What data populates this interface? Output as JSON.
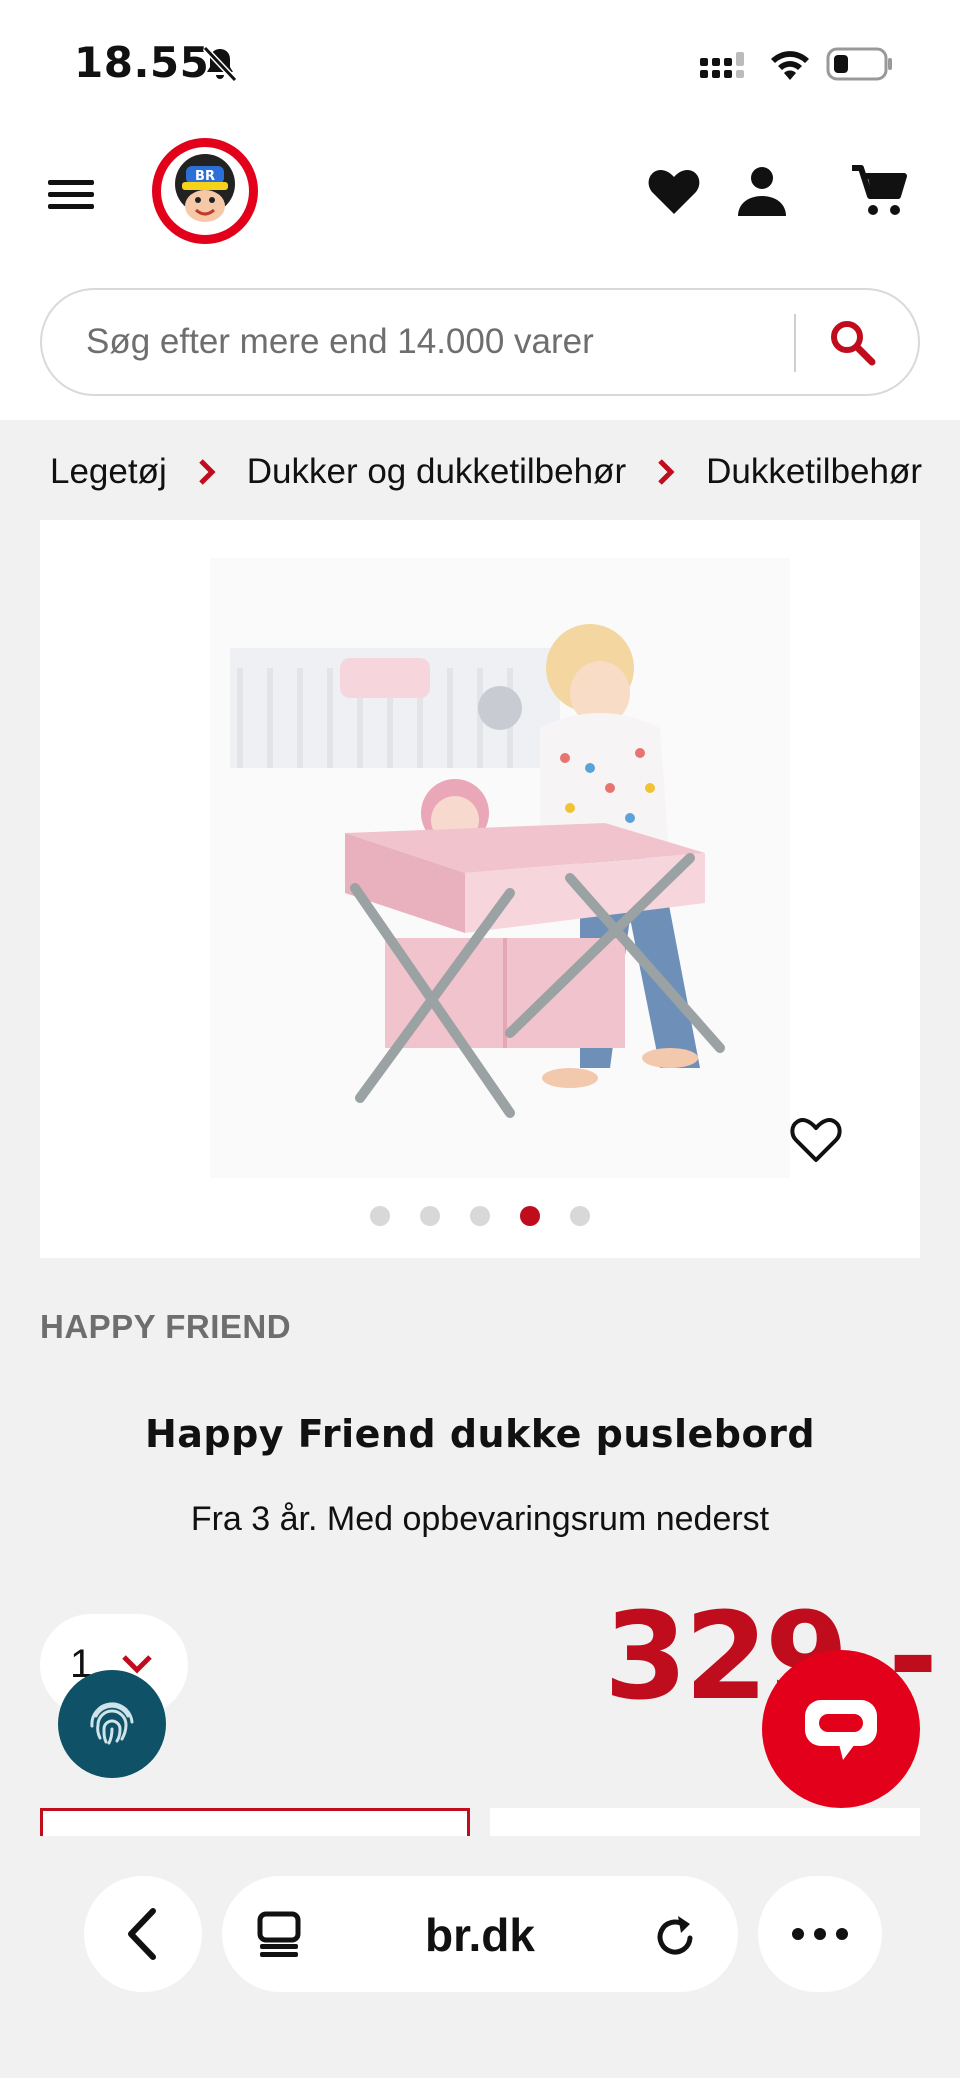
{
  "status_bar": {
    "time": "18.55"
  },
  "search": {
    "placeholder": "Søg efter mere end 14.000 varer"
  },
  "breadcrumb": [
    "Legetøj",
    "Dukker og dukketilbehør",
    "Dukketilbehør"
  ],
  "gallery": {
    "slide_count": 5,
    "active_slide": 4
  },
  "product": {
    "brand": "HAPPY FRIEND",
    "title": "Happy Friend dukke puslebord",
    "subtitle": "Fra 3 år. Med opbevaringsrum nederst",
    "quantity": "1",
    "price": "329,-"
  },
  "browser": {
    "url": "br.dk"
  },
  "colors": {
    "brand_red": "#c00d1e",
    "chat_red": "#e3001b",
    "fingerprint_teal": "#0f5166"
  }
}
